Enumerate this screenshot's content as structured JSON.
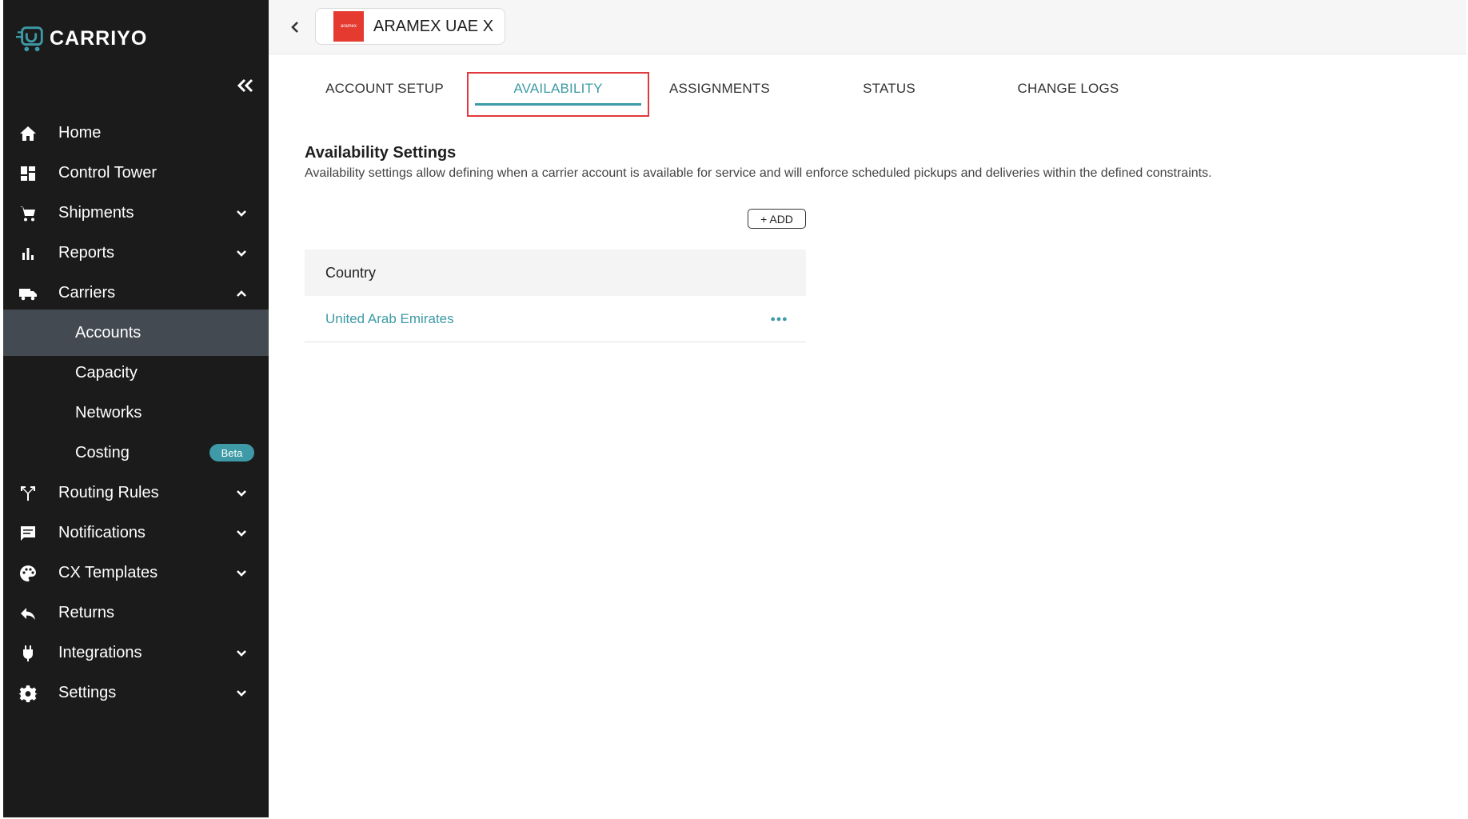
{
  "brand": {
    "name": "CARRIYO"
  },
  "sidebar": {
    "items": [
      {
        "label": "Home",
        "icon": "home-icon"
      },
      {
        "label": "Control Tower",
        "icon": "dashboard-icon"
      },
      {
        "label": "Shipments",
        "icon": "cart-icon"
      },
      {
        "label": "Reports",
        "icon": "bar-chart-icon"
      },
      {
        "label": "Carriers",
        "icon": "truck-icon"
      },
      {
        "label": "Routing Rules",
        "icon": "routing-icon"
      },
      {
        "label": "Notifications",
        "icon": "message-icon"
      },
      {
        "label": "CX Templates",
        "icon": "palette-icon"
      },
      {
        "label": "Returns",
        "icon": "reply-icon"
      },
      {
        "label": "Integrations",
        "icon": "plug-icon"
      },
      {
        "label": "Settings",
        "icon": "gear-icon"
      }
    ],
    "carrier_sub": [
      {
        "label": "Accounts"
      },
      {
        "label": "Capacity"
      },
      {
        "label": "Networks"
      },
      {
        "label": "Costing",
        "badge": "Beta"
      }
    ]
  },
  "header": {
    "carrier_name": "ARAMEX UAE X",
    "carrier_logo_text": "aramex"
  },
  "tabs": [
    {
      "label": "ACCOUNT SETUP"
    },
    {
      "label": "AVAILABILITY"
    },
    {
      "label": "ASSIGNMENTS"
    },
    {
      "label": "STATUS"
    },
    {
      "label": "CHANGE LOGS"
    }
  ],
  "availability": {
    "title": "Availability Settings",
    "description": "Availability settings allow defining when a carrier account is available for service and will enforce scheduled pickups and deliveries within the defined constraints.",
    "add_label": "+ ADD",
    "table": {
      "header": "Country",
      "rows": [
        {
          "country": "United Arab Emirates"
        }
      ]
    }
  },
  "colors": {
    "sidebar_bg": "#1b1b1b",
    "accent": "#3d9aa6",
    "active_sub_bg": "#444a52",
    "highlight_red": "#e0393e",
    "aramex_red": "#e53a2f"
  }
}
